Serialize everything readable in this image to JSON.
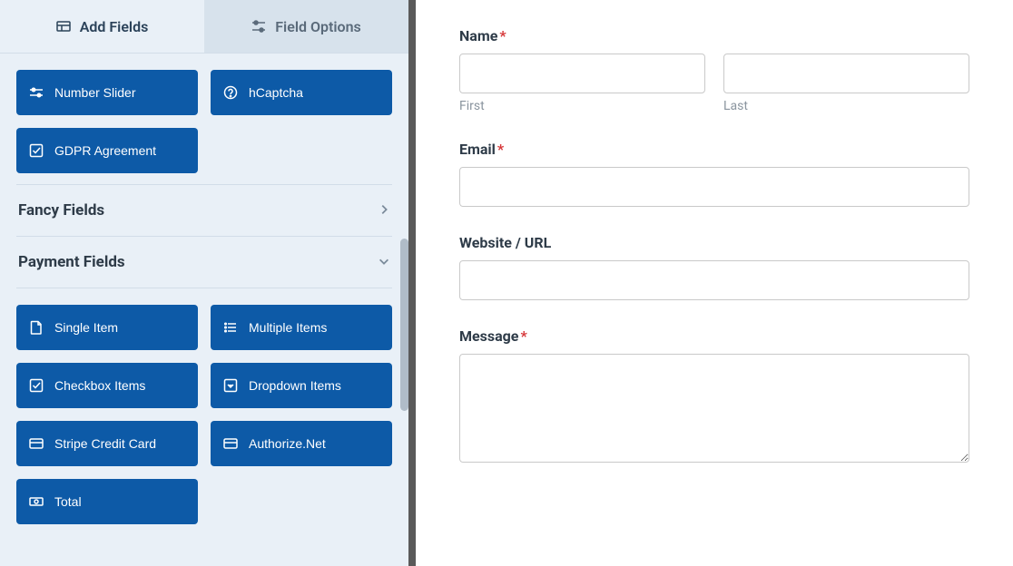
{
  "tabs": {
    "add_fields": "Add Fields",
    "field_options": "Field Options"
  },
  "misc_fields": [
    {
      "label": "Number Slider",
      "icon": "sliders"
    },
    {
      "label": "hCaptcha",
      "icon": "help-circle"
    },
    {
      "label": "GDPR Agreement",
      "icon": "check-square"
    }
  ],
  "sections": {
    "fancy": {
      "title": "Fancy Fields",
      "expanded": false
    },
    "payment": {
      "title": "Payment Fields",
      "expanded": true
    }
  },
  "payment_fields": [
    {
      "label": "Single Item",
      "icon": "file"
    },
    {
      "label": "Multiple Items",
      "icon": "list"
    },
    {
      "label": "Checkbox Items",
      "icon": "check-square"
    },
    {
      "label": "Dropdown Items",
      "icon": "caret-square"
    },
    {
      "label": "Stripe Credit Card",
      "icon": "credit-card"
    },
    {
      "label": "Authorize.Net",
      "icon": "credit-card"
    },
    {
      "label": "Total",
      "icon": "money"
    }
  ],
  "form": {
    "name": {
      "label": "Name",
      "required": true,
      "first_sub": "First",
      "last_sub": "Last"
    },
    "email": {
      "label": "Email",
      "required": true
    },
    "website": {
      "label": "Website / URL",
      "required": false
    },
    "message": {
      "label": "Message",
      "required": true
    }
  }
}
